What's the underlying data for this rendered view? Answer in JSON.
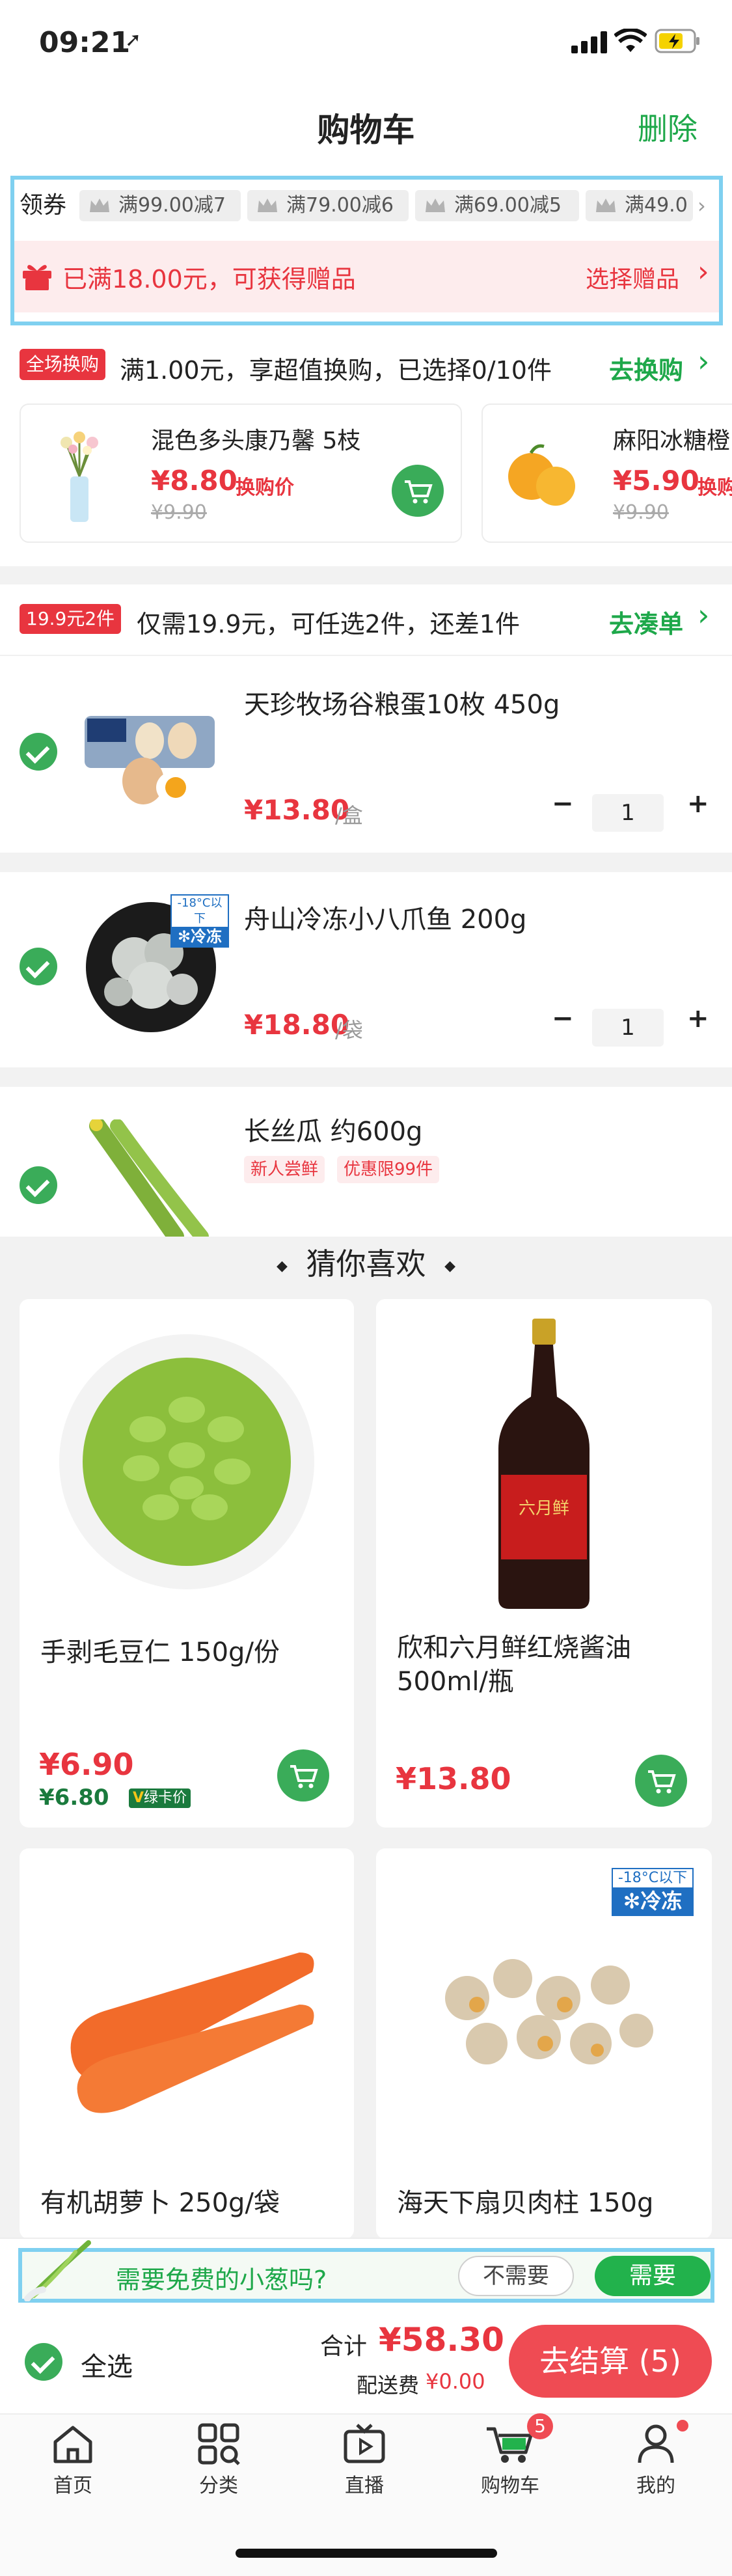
{
  "status_bar": {
    "time": "09:21"
  },
  "header": {
    "title": "购物车",
    "delete_label": "删除"
  },
  "coupons": {
    "label": "领券",
    "items": [
      "满99.00减7",
      "满79.00减6",
      "满69.00减5",
      "满49.0"
    ]
  },
  "gift": {
    "text": "已满18.00元，可获得赠品",
    "action": "选择赠品"
  },
  "exchange": {
    "badge": "全场换购",
    "text": "满1.00元，享超值换购，已选择0/10件",
    "action": "去换购",
    "items": [
      {
        "name": "混色多头康乃馨 5枝",
        "price": "¥8.80",
        "price_label": "换购价",
        "orig": "¥9.90"
      },
      {
        "name": "麻阳冰糖橙",
        "price": "¥5.90",
        "price_label": "换购",
        "orig": "¥9.90"
      }
    ]
  },
  "bundle": {
    "badge": "19.9元2件",
    "text": "仅需19.9元，可任选2件，还差1件",
    "action": "去凑单"
  },
  "cart_items": [
    {
      "name": "天珍牧场谷粮蛋10枚 450g",
      "price": "¥13.80",
      "unit": "/盒",
      "qty": "1"
    },
    {
      "name": "舟山冷冻小八爪鱼 200g",
      "price": "¥18.80",
      "unit": "/袋",
      "qty": "1",
      "badge_top": "-18°C以下",
      "badge_bottom": "冷冻"
    },
    {
      "name": "长丝瓜 约600g",
      "tags": [
        "新人尝鲜",
        "优惠限99件"
      ]
    }
  ],
  "recommend": {
    "title": "猜你喜欢",
    "items": [
      {
        "name": "手剥毛豆仁 150g/份",
        "price": "¥6.90",
        "vip_price": "¥6.80",
        "vip_label": "绿卡价"
      },
      {
        "name": "欣和六月鲜红烧酱油500ml/瓶",
        "price": "¥13.80",
        "bottle_brand": "六月鲜"
      },
      {
        "name": "有机胡萝卜 250g/袋"
      },
      {
        "name": "海天下扇贝肉柱 150g",
        "badge_top": "-18°C以下",
        "badge_bottom": "冷冻"
      }
    ]
  },
  "scallion": {
    "text": "需要免费的小葱吗?",
    "decline": "不需要",
    "accept": "需要"
  },
  "checkout": {
    "select_all": "全选",
    "total_label": "合计",
    "total": "¥58.30",
    "shipping_label": "配送费",
    "shipping": "¥0.00",
    "button": "去结算 (5)"
  },
  "tabbar": {
    "items": [
      "首页",
      "分类",
      "直播",
      "购物车",
      "我的"
    ],
    "cart_badge": "5"
  },
  "colors": {
    "green": "#1ea84a",
    "red": "#e8353f",
    "highlight_border": "#7fd0f0"
  }
}
